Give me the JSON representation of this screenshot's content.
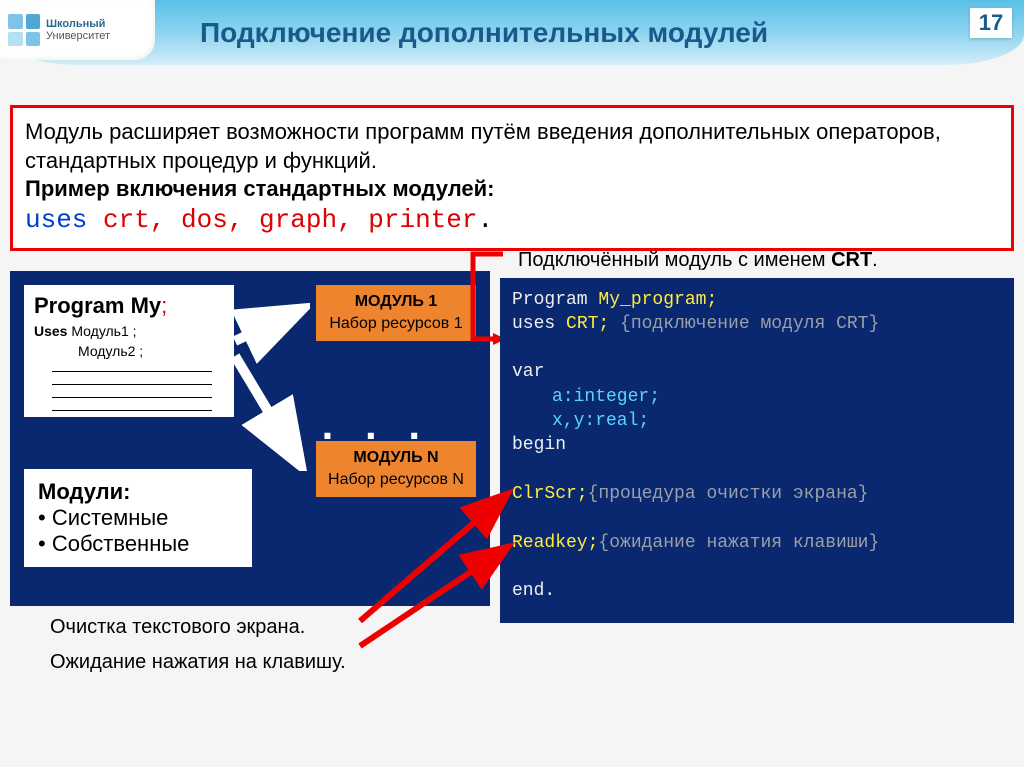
{
  "header": {
    "logo_line1": "Школьный",
    "logo_line2": "Университет",
    "title": "Подключение дополнительных модулей",
    "page": "17"
  },
  "info": {
    "line1": "Модуль расширяет возможности программ путём введения дополнительных операторов, стандартных процедур и функций.",
    "line2": "Пример включения стандартных модулей:",
    "code_uses": "uses",
    "code_list": " crt, dos, graph, printer",
    "code_dot": "."
  },
  "diagram": {
    "prog_title": "Program My",
    "prog_semi": ";",
    "uses_label": "Uses",
    "mod_a": "  Модуль1 ;",
    "mod_b": "Модуль2 ;",
    "module1_title": "МОДУЛЬ 1",
    "module1_sub": "Набор ресурсов 1",
    "moduleN_title": "МОДУЛЬ N",
    "moduleN_sub": "Набор ресурсов N",
    "dots": ". . .",
    "types_header": "Модули:",
    "type1": "Системные",
    "type2": "Собственные"
  },
  "captions": {
    "c1": "Очистка текстового экрана.",
    "c2": "Ожидание нажатия на клавишу."
  },
  "annot": {
    "prefix": "Подключённый модуль с именем ",
    "name": "CRT",
    "suffix": "."
  },
  "code": {
    "l1a": "Program ",
    "l1b": "My_program;",
    "l2a": "uses ",
    "l2b": "CRT; ",
    "l2c": "{подключение модуля CRT}",
    "l3": "var",
    "l4": "a:integer;",
    "l5": "x,y:real;",
    "l6": "begin",
    "l7a": "ClrScr;",
    "l7b": "{процедура очистки экрана}",
    "l8a": "Readkey;",
    "l8b": "{ожидание нажатия клавиши}",
    "l9": "end."
  }
}
